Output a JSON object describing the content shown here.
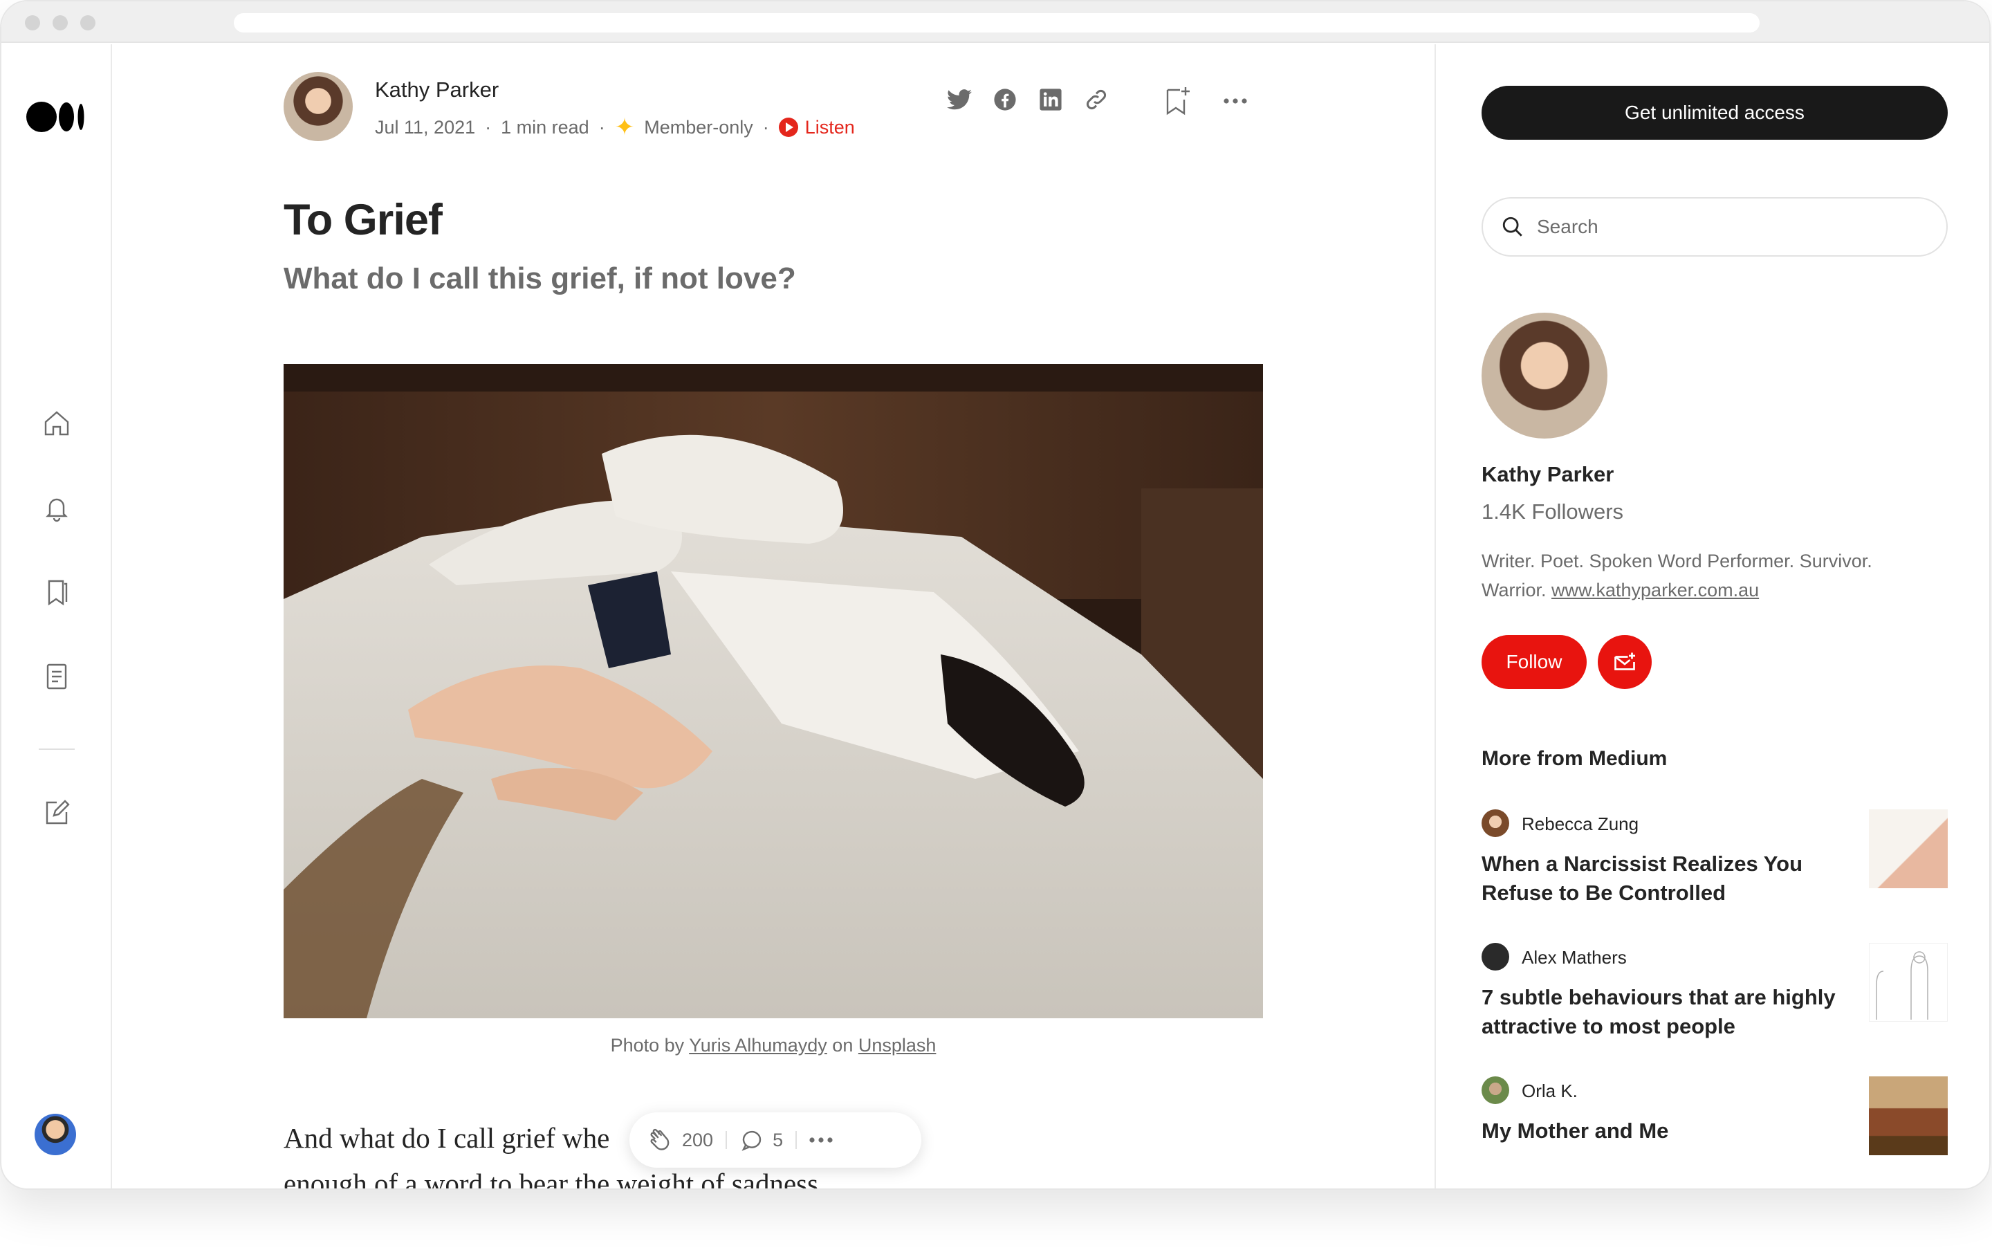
{
  "nav": {
    "items": [
      "home",
      "notifications",
      "lists",
      "stories",
      "write"
    ]
  },
  "article": {
    "author": "Kathy Parker",
    "date": "Jul 11, 2021",
    "read_time": "1 min read",
    "member_label": "Member-only",
    "listen_label": "Listen",
    "title": "To Grief",
    "subtitle": "What do I call this grief, if not love?",
    "caption_prefix": "Photo by ",
    "caption_photographer": "Yuris Alhumaydy",
    "caption_mid": " on ",
    "caption_source": "Unsplash",
    "body_line1": "And what do I call grief whe",
    "body_line2": "enough of a word to bear the weight of sadness",
    "claps": "200",
    "responses": "5"
  },
  "sidebar": {
    "cta_label": "Get unlimited access",
    "search_placeholder": "Search",
    "profile_name": "Kathy Parker",
    "followers": "1.4K Followers",
    "bio_text": "Writer. Poet. Spoken Word Performer. Survivor. Warrior. ",
    "bio_link": "www.kathyparker.com.au",
    "follow_label": "Follow",
    "more_from_heading": "More from Medium",
    "recommendations": [
      {
        "author": "Rebecca Zung",
        "title": "When a Narcissist Realizes You Refuse to Be Controlled"
      },
      {
        "author": "Alex Mathers",
        "title": "7 subtle behaviours that are highly attractive to most people"
      },
      {
        "author": "Orla K.",
        "title": "My Mother and Me"
      }
    ]
  },
  "colors": {
    "accent_red": "#e8140f",
    "member_star": "#ffc017",
    "cta_dark": "#191919"
  }
}
